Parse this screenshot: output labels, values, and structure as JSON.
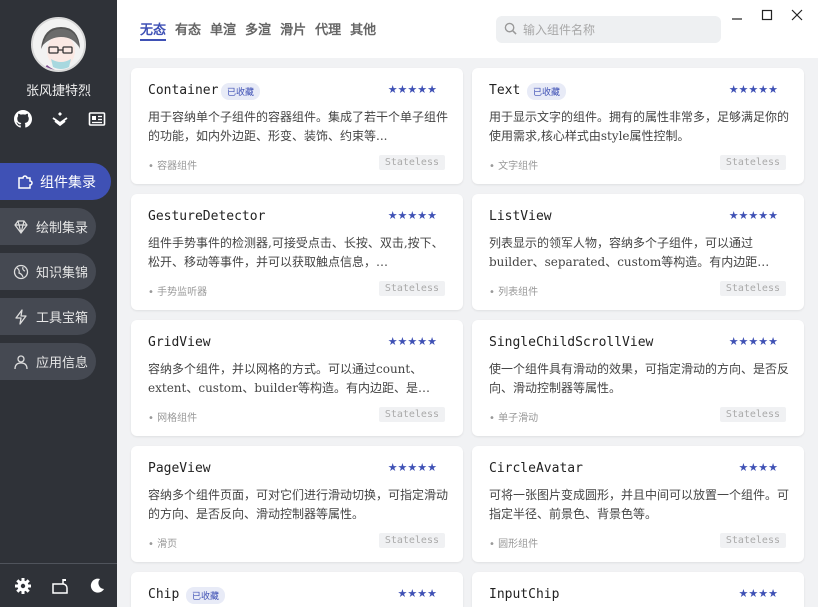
{
  "sidebar": {
    "username": "张风捷特烈",
    "social_icons": [
      "github-icon",
      "juejin-icon",
      "blog-icon"
    ],
    "nav": [
      {
        "label": "组件集录",
        "icon": "puzzle-icon",
        "active": true
      },
      {
        "label": "绘制集录",
        "icon": "diamond-icon",
        "active": false
      },
      {
        "label": "知识集锦",
        "icon": "globe-icon",
        "active": false
      },
      {
        "label": "工具宝箱",
        "icon": "lightning-icon",
        "active": false
      },
      {
        "label": "应用信息",
        "icon": "person-icon",
        "active": false
      }
    ],
    "bottom_icons": [
      "settings-icon",
      "mailbox-icon",
      "dark-mode-icon"
    ]
  },
  "header": {
    "tabs": [
      "无态",
      "有态",
      "单渲",
      "多渲",
      "滑片",
      "代理",
      "其他"
    ],
    "active_tab": 0,
    "search": {
      "placeholder": "输入组件名称"
    }
  },
  "colors": {
    "accent": "#3f51b5",
    "sidebar": "#2f3238"
  },
  "cards": [
    {
      "name": "Container",
      "fav": "已收藏",
      "stars": "★★★★★",
      "desc": "用于容纳单个子组件的容器组件。集成了若干个单子组件的功能，如内外边距、形变、装饰、约束等...",
      "category": "容器组件",
      "type": "Stateless"
    },
    {
      "name": "Text",
      "fav": "已收藏",
      "stars": "★★★★★",
      "desc": "用于显示文字的组件。拥有的属性非常多，足够满足你的使用需求,核心样式由style属性控制。",
      "category": "文字组件",
      "type": "Stateless"
    },
    {
      "name": "GestureDetector",
      "fav": "",
      "stars": "★★★★★",
      "desc": "组件手势事件的检测器,可接受点击、长按、双击,按下、松开、移动等事件，并可以获取触点信息，…",
      "category": "手势监听器",
      "type": "Stateless"
    },
    {
      "name": "ListView",
      "fav": "",
      "stars": "★★★★★",
      "desc": "列表显示的领军人物，容纳多个子组件，可以通过builder、separated、custom等构造。有内边距…",
      "category": "列表组件",
      "type": "Stateless"
    },
    {
      "name": "GridView",
      "fav": "",
      "stars": "★★★★★",
      "desc": "容纳多个组件，并以网格的方式。可以通过count、extent、custom、builder等构造。有内边距、是…",
      "category": "网格组件",
      "type": "Stateless"
    },
    {
      "name": "SingleChildScrollView",
      "fav": "",
      "stars": "★★★★★",
      "desc": "使一个组件具有滑动的效果，可指定滑动的方向、是否反向、滑动控制器等属性。",
      "category": "单子滑动",
      "type": "Stateless"
    },
    {
      "name": "PageView",
      "fav": "",
      "stars": "★★★★★",
      "desc": "容纳多个组件页面，可对它们进行滑动切换，可指定滑动的方向、是否反向、滑动控制器等属性。",
      "category": "滑页",
      "type": "Stateless"
    },
    {
      "name": "CircleAvatar",
      "fav": "",
      "stars": "★★★★",
      "desc": "可将一张图片变成圆形，并且中间可以放置一个组件。可指定半径、前景色、背景色等。",
      "category": "圆形组件",
      "type": "Stateless"
    },
    {
      "name": "Chip",
      "fav": "已收藏",
      "stars": "★★★★",
      "desc": "",
      "category": "",
      "type": ""
    },
    {
      "name": "InputChip",
      "fav": "",
      "stars": "★★★★",
      "desc": "",
      "category": "",
      "type": ""
    }
  ]
}
